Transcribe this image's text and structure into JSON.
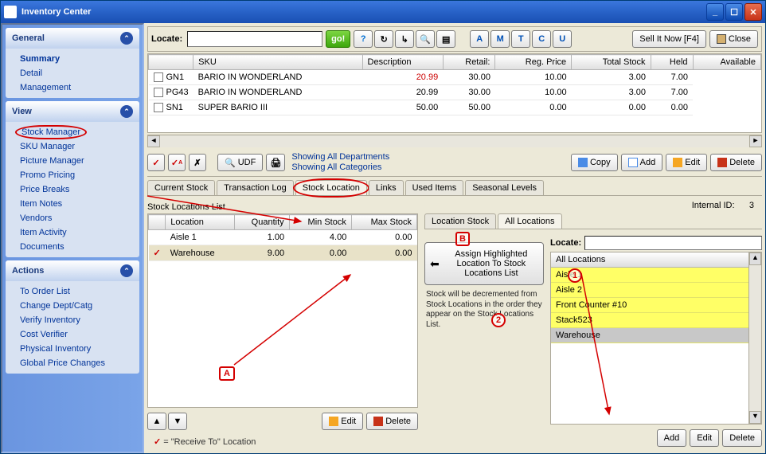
{
  "window": {
    "title": "Inventory Center"
  },
  "sidebar": {
    "panels": [
      {
        "title": "General",
        "items": [
          {
            "label": "Summary",
            "sel": true
          },
          {
            "label": "Detail"
          },
          {
            "label": "Management"
          }
        ]
      },
      {
        "title": "View",
        "items": [
          {
            "label": "Stock Manager",
            "circled": true
          },
          {
            "label": "SKU Manager"
          },
          {
            "label": "Picture Manager"
          },
          {
            "label": "Promo Pricing"
          },
          {
            "label": "Price Breaks"
          },
          {
            "label": "Item Notes"
          },
          {
            "label": "Vendors"
          },
          {
            "label": "Item Activity"
          },
          {
            "label": "Documents"
          }
        ]
      },
      {
        "title": "Actions",
        "items": [
          {
            "label": "To Order List"
          },
          {
            "label": "Change Dept/Catg"
          },
          {
            "label": "Verify Inventory"
          },
          {
            "label": "Cost Verifier"
          },
          {
            "label": "Physical Inventory"
          },
          {
            "label": "Global Price Changes"
          }
        ]
      }
    ]
  },
  "toolbar": {
    "locate_label": "Locate:",
    "go": "go!",
    "sell": "Sell It Now [F4]",
    "close": "Close",
    "letters": [
      "A",
      "M",
      "T",
      "C",
      "U"
    ]
  },
  "grid": {
    "cols": [
      "SKU",
      "Description",
      "Retail:",
      "Reg. Price",
      "Total Stock",
      "Held",
      "Available"
    ],
    "rows": [
      {
        "sku": "GN1",
        "desc": "BARIO IN WONDERLAND",
        "retail": "20.99",
        "reg": "30.00",
        "total": "10.00",
        "held": "3.00",
        "avail": "7.00",
        "retail_red": true
      },
      {
        "sku": "PG43",
        "desc": "BARIO IN WONDERLAND",
        "retail": "20.99",
        "reg": "30.00",
        "total": "10.00",
        "held": "3.00",
        "avail": "7.00"
      },
      {
        "sku": "SN1",
        "desc": "SUPER BARIO III",
        "retail": "50.00",
        "reg": "50.00",
        "total": "0.00",
        "held": "0.00",
        "avail": "0.00"
      }
    ]
  },
  "filter": {
    "udf": "UDF",
    "line1": "Showing All Departments",
    "line2": "Showing All Categories",
    "copy": "Copy",
    "add": "Add",
    "edit": "Edit",
    "del": "Delete"
  },
  "detailtabs": [
    "Current Stock",
    "Transaction Log",
    "Stock Location",
    "Links",
    "Used Items",
    "Seasonal Levels"
  ],
  "detailtabs_active": 2,
  "stockloc": {
    "title": "Stock Locations List",
    "cols": [
      "Location",
      "Quantity",
      "Min Stock",
      "Max Stock"
    ],
    "rows": [
      {
        "loc": "Aisle 1",
        "qty": "1.00",
        "min": "4.00",
        "max": "0.00"
      },
      {
        "loc": "Warehouse",
        "qty": "9.00",
        "min": "0.00",
        "max": "0.00",
        "receive": true,
        "sel": true
      }
    ],
    "edit": "Edit",
    "del": "Delete",
    "legend": " = \"Receive To\" Location"
  },
  "internal": {
    "label": "Internal ID:",
    "value": "3"
  },
  "subtabs": [
    "Location Stock",
    "All Locations"
  ],
  "subtabs_active": 1,
  "assign": {
    "label": "Assign Highlighted Location To Stock Locations List"
  },
  "decrement": "Stock will be decremented from Stock Locations in the order they appear on the Stock Locations List.",
  "locpanel": {
    "locate": "Locate:",
    "header": "All Locations",
    "items": [
      {
        "label": "Aisle 1"
      },
      {
        "label": "Aisle 2"
      },
      {
        "label": "Front Counter #10"
      },
      {
        "label": "Stack523"
      },
      {
        "label": "Warehouse",
        "sel": true
      }
    ],
    "add": "Add",
    "edit": "Edit",
    "del": "Delete"
  },
  "markers": {
    "A": "A",
    "B": "B",
    "1": "1",
    "2": "2"
  }
}
